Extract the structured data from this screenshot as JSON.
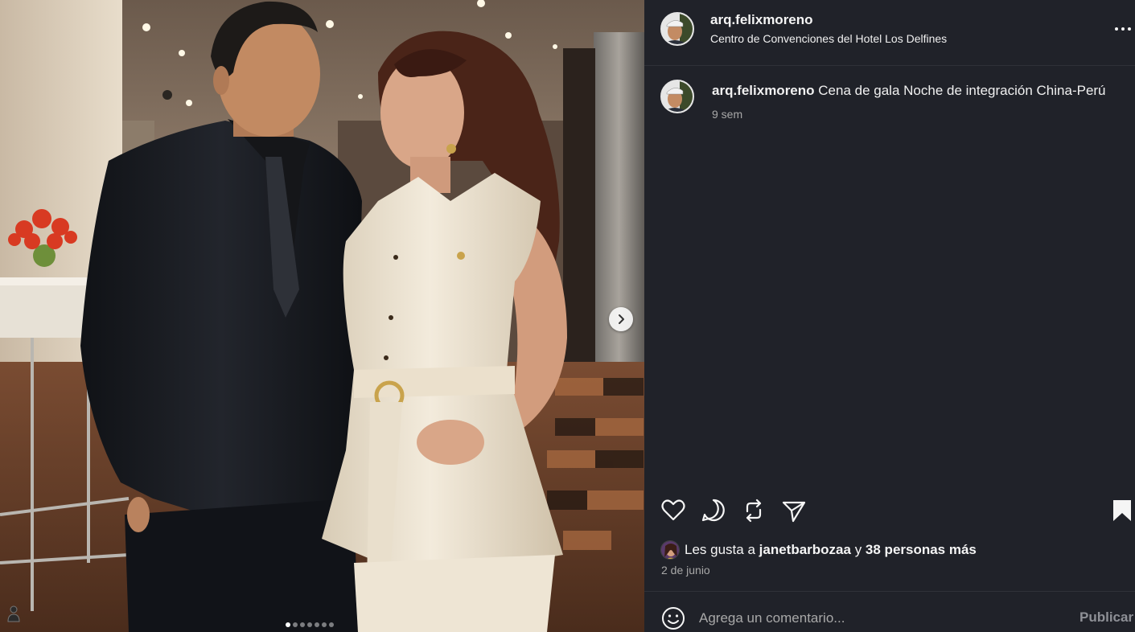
{
  "post": {
    "username": "arq.felixmoreno",
    "location": "Centro de Convenciones del Hotel Los Delfines",
    "caption_user": "arq.felixmoreno",
    "caption": "Cena de gala Noche de integración China-Perú",
    "caption_time": "9 sem",
    "likes_prefix": "Les gusta a",
    "liked_by": "janetbarbozaa",
    "likes_joiner": "y",
    "likes_others": "38 personas más",
    "date": "2 de junio"
  },
  "carousel": {
    "slide_count": 7,
    "active_index": 0
  },
  "comment": {
    "placeholder": "Agrega un comentario...",
    "publish_label": "Publicar"
  },
  "icons": {
    "like": "heart-icon",
    "comment": "comment-icon",
    "repost": "repost-icon",
    "share": "send-icon",
    "save": "bookmark-icon",
    "emoji": "emoji-icon",
    "more": "more-options-icon",
    "next": "chevron-right-icon"
  },
  "colors": {
    "panel_bg": "#202229",
    "text_primary": "#f5f5f5",
    "text_secondary": "#a8a8a8"
  }
}
